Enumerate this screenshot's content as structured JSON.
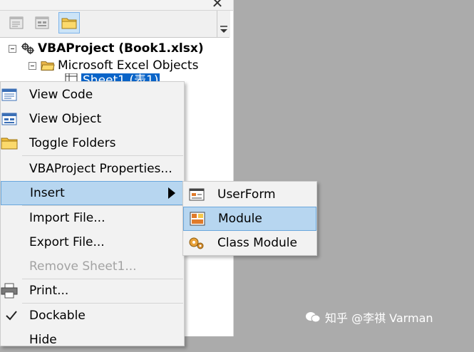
{
  "project_tree": {
    "root_label": "VBAProject (Book1.xlsx)",
    "folder_label": "Microsoft Excel Objects",
    "selected_item_label": "Sheet1 (表1)"
  },
  "toolbar": {
    "view_code_icon": "view-code-icon",
    "view_object_icon": "view-object-icon",
    "toggle_folders_icon": "folder-icon"
  },
  "context_menu": {
    "items": [
      {
        "label": "View Code",
        "icon": "view-code-icon"
      },
      {
        "label": "View Object",
        "icon": "view-object-icon"
      },
      {
        "label": "Toggle Folders",
        "icon": "folder-icon"
      },
      {
        "label": "VBAProject Properties..."
      },
      {
        "label": "Insert",
        "has_submenu": true,
        "highlighted": true
      },
      {
        "label": "Import File..."
      },
      {
        "label": "Export File..."
      },
      {
        "label": "Remove Sheet1...",
        "disabled": true
      },
      {
        "label": "Print...",
        "icon": "printer-icon"
      },
      {
        "label": "Dockable",
        "checked": true
      },
      {
        "label": "Hide"
      }
    ]
  },
  "insert_submenu": {
    "items": [
      {
        "label": "UserForm",
        "icon": "userform-icon"
      },
      {
        "label": "Module",
        "icon": "module-icon",
        "highlighted": true
      },
      {
        "label": "Class Module",
        "icon": "class-module-icon"
      }
    ]
  },
  "watermark": {
    "text": "知乎 @李祺 Varman"
  },
  "colors": {
    "highlight": "#b7d6f0",
    "highlight_border": "#6aa7dc",
    "disabled_text": "#a3a3a3",
    "background": "#ababab"
  }
}
